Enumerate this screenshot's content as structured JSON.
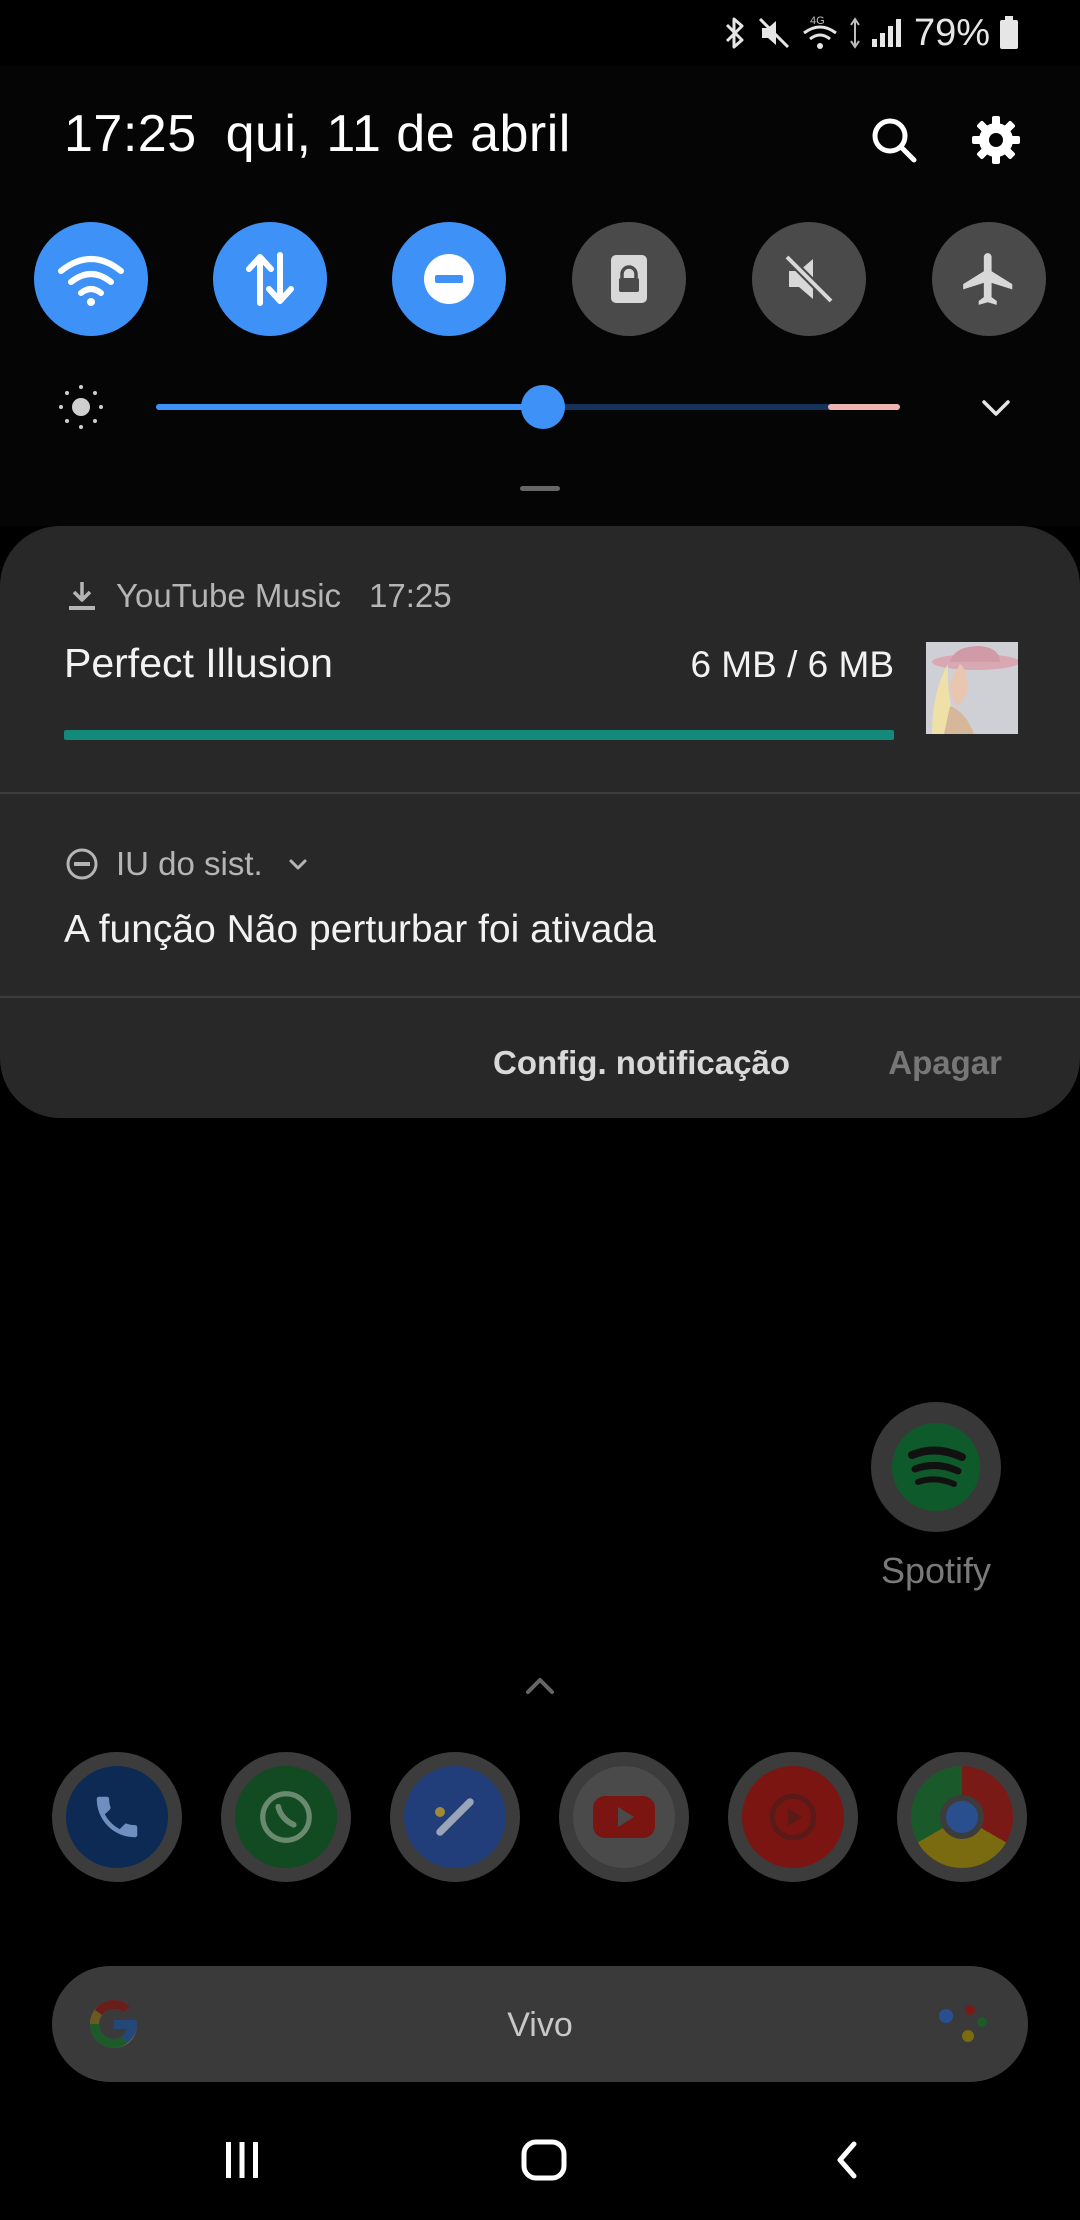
{
  "status_bar": {
    "battery_percent": "79%",
    "network_type": "4G",
    "icons": [
      "bluetooth-icon",
      "mute-icon",
      "wifi-icon",
      "data-arrows-icon",
      "signal-icon",
      "battery-icon"
    ]
  },
  "quick_panel": {
    "time": "17:25",
    "date": "qui, 11 de abril",
    "actions": [
      "search-icon",
      "settings-gear-icon"
    ],
    "toggles": [
      {
        "name": "wifi",
        "icon": "wifi-icon",
        "state": "on"
      },
      {
        "name": "mobile-data",
        "icon": "data-transfer-icon",
        "state": "on"
      },
      {
        "name": "do-not-disturb",
        "icon": "do-not-disturb-icon",
        "state": "on"
      },
      {
        "name": "screen-lock",
        "icon": "lock-icon",
        "state": "off"
      },
      {
        "name": "sound",
        "icon": "mute-icon",
        "state": "off"
      },
      {
        "name": "airplane-mode",
        "icon": "airplane-icon",
        "state": "off"
      }
    ],
    "brightness_level": 0.52,
    "accent_color": "#3e91f7"
  },
  "notifications": [
    {
      "app": "YouTube Music",
      "time": "17:25",
      "icon": "download-icon",
      "title": "Perfect Illusion",
      "size_text": "6 MB / 6 MB",
      "progress": 1.0,
      "progress_color": "#12897a"
    },
    {
      "app": "IU do sist.",
      "icon": "do-not-disturb-icon",
      "title": "A função Não perturbar foi ativada"
    }
  ],
  "notification_actions": {
    "settings_label": "Config. notificação",
    "clear_label": "Apagar"
  },
  "home": {
    "spotify_label": "Spotify",
    "dock_apps": [
      "phone",
      "whatsapp",
      "google-tasks",
      "youtube",
      "youtube-music",
      "chrome"
    ],
    "search_label": "Vivo"
  }
}
